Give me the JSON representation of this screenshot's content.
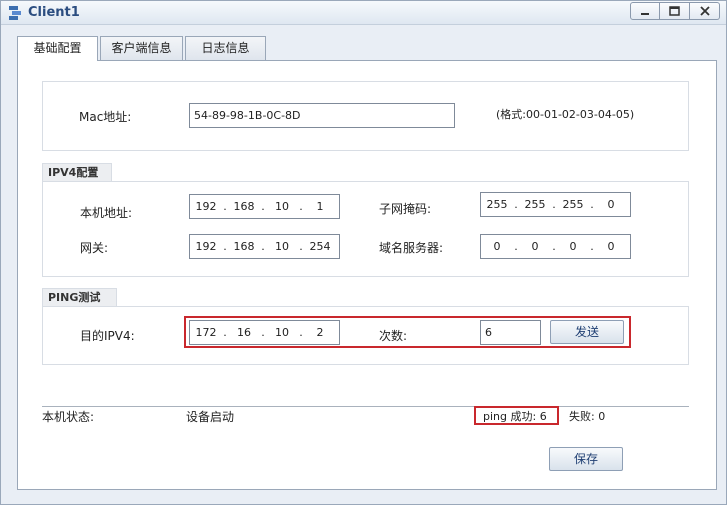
{
  "window": {
    "title": "Client1",
    "controls": {
      "minimize": "minimize-icon",
      "maximize": "maximize-icon",
      "close": "close-icon"
    }
  },
  "tabs": [
    {
      "label": "基础配置",
      "active": true
    },
    {
      "label": "客户端信息",
      "active": false
    },
    {
      "label": "日志信息",
      "active": false
    }
  ],
  "mac": {
    "label": "Mac地址:",
    "value": "54-89-98-1B-0C-8D",
    "format_hint": "(格式:00-01-02-03-04-05)"
  },
  "ipv4": {
    "group_label": "IPV4配置",
    "local_ip_label": "本机地址:",
    "local_ip": [
      "192",
      "168",
      "10",
      "1"
    ],
    "subnet_label": "子网掩码:",
    "subnet": [
      "255",
      "255",
      "255",
      "0"
    ],
    "gateway_label": "网关:",
    "gateway": [
      "192",
      "168",
      "10",
      "254"
    ],
    "dns_label": "域名服务器:",
    "dns": [
      "0",
      "0",
      "0",
      "0"
    ]
  },
  "ping": {
    "group_label": "PING测试",
    "dest_label": "目的IPV4:",
    "dest": [
      "172",
      "16",
      "10",
      "2"
    ],
    "count_label": "次数:",
    "count": "6",
    "send_label": "发送"
  },
  "status": {
    "label": "本机状态:",
    "value": "设备启动",
    "ping_success": "ping 成功: 6",
    "fail": "失败: 0"
  },
  "save_label": "保存",
  "colors": {
    "highlight": "#c9282d",
    "title": "#2b4d80"
  }
}
